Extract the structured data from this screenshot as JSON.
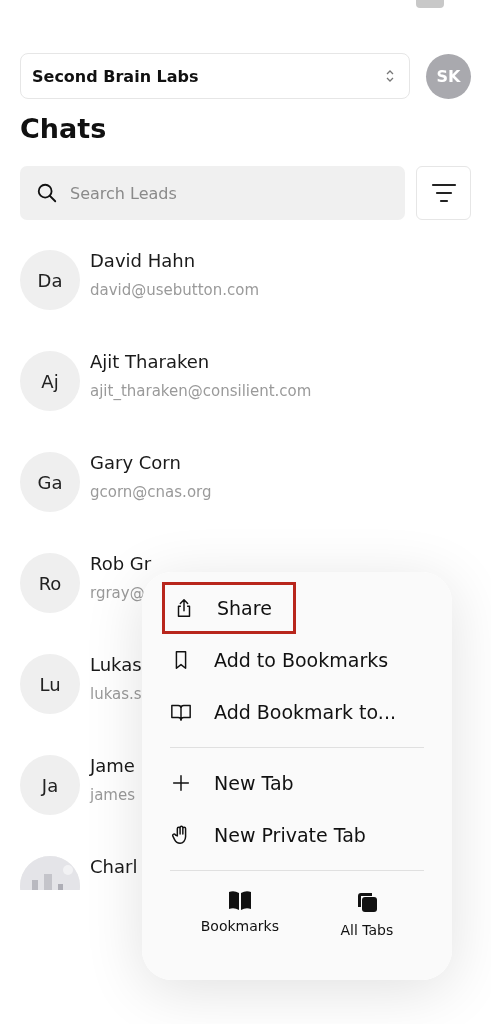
{
  "workspace_selector": {
    "value": "Second Brain Labs"
  },
  "profile": {
    "initials": "SK"
  },
  "title": "Chats",
  "search": {
    "placeholder": "Search Leads"
  },
  "leads": [
    {
      "kind": "initials",
      "initials": "Da",
      "name": "David Hahn",
      "email": "david@usebutton.com"
    },
    {
      "kind": "initials",
      "initials": "Aj",
      "name": "Ajit Tharaken",
      "email": "ajit_tharaken@consilient.com"
    },
    {
      "kind": "initials",
      "initials": "Ga",
      "name": "Gary Corn",
      "email": "gcorn@cnas.org"
    },
    {
      "kind": "initials",
      "initials": "Ro",
      "name": "Rob Gr",
      "email": "rgray@"
    },
    {
      "kind": "initials",
      "initials": "Lu",
      "name": "Lukas",
      "email": "lukas.s"
    },
    {
      "kind": "initials",
      "initials": "Ja",
      "name": "Jame",
      "email": "james"
    },
    {
      "kind": "picture",
      "name": "Charl"
    }
  ],
  "menu": {
    "items": [
      {
        "kind": "share",
        "label": "Share",
        "highlighted": true
      },
      {
        "kind": "bookmark",
        "label": "Add to Bookmarks",
        "highlighted": false
      },
      {
        "kind": "book",
        "label": "Add Bookmark to...",
        "highlighted": false
      },
      {
        "kind": "divider"
      },
      {
        "kind": "plus",
        "label": "New Tab",
        "highlighted": false
      },
      {
        "kind": "hand",
        "label": "New Private Tab",
        "highlighted": false
      },
      {
        "kind": "divider"
      }
    ],
    "bottom": [
      {
        "kind": "bookmarks",
        "label": "Bookmarks"
      },
      {
        "kind": "tabs",
        "label": "All Tabs"
      }
    ]
  }
}
